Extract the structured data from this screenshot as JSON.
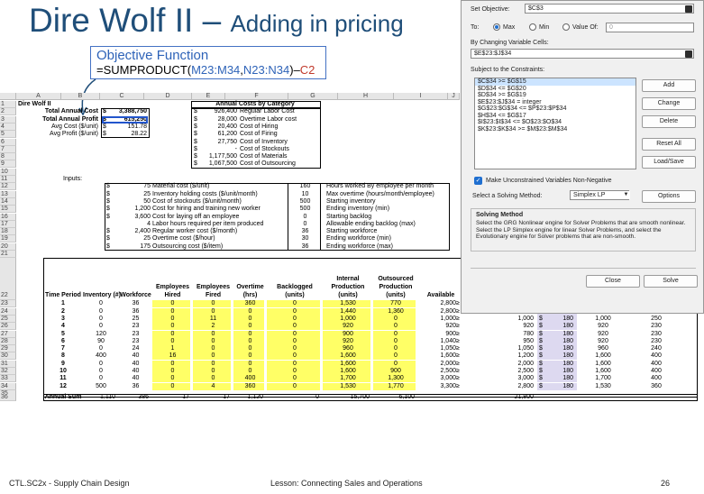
{
  "slide": {
    "title_main": "Dire Wolf II – ",
    "title_sub": "Adding in pricing",
    "footer_left": "CTL.SC2x - Supply Chain Design",
    "footer_center": "Lesson:  Connecting Sales and Operations",
    "page_number": "26"
  },
  "callout": {
    "heading": "Objective Function",
    "prefix": "=SUMPRODUCT(",
    "range1": "M23:M34",
    "comma": ",",
    "range2": "N23:N34",
    "close": ")–",
    "minus": "C2"
  },
  "sheet": {
    "columns": [
      "A",
      "B",
      "C",
      "D",
      "E",
      "F",
      "G",
      "H",
      "I",
      "J"
    ],
    "rows": [
      "1",
      "2",
      "3",
      "4",
      "5",
      "6",
      "7",
      "8",
      "9",
      "10",
      "11",
      "12",
      "13",
      "14",
      "15",
      "16",
      "17",
      "18",
      "19",
      "20",
      "21",
      "22",
      "23",
      "24",
      "25",
      "26",
      "27",
      "28",
      "29",
      "30",
      "31",
      "32",
      "33",
      "34",
      "35",
      "36"
    ],
    "a1": "Dire Wolf II",
    "summary": [
      {
        "label": "Total Annual Cost",
        "cur": "$",
        "value": "3,388,750"
      },
      {
        "label": "Total Annual Profit",
        "cur": "$",
        "value": "615,250"
      },
      {
        "label": "Avg Cost ($/unit)",
        "cur": "$",
        "value": "151.78"
      },
      {
        "label": "Avg Profit ($/unit)",
        "cur": "$",
        "value": "28.22"
      }
    ],
    "cost_title": "Annual Costs by Category",
    "costs": [
      {
        "cur": "$",
        "value": "926,400",
        "label": "Regular Labor Cost"
      },
      {
        "cur": "$",
        "value": "28,000",
        "label": "Overtime Labor cost"
      },
      {
        "cur": "$",
        "value": "20,400",
        "label": "Cost of Hiring"
      },
      {
        "cur": "$",
        "value": "61,200",
        "label": "Cost of Firing"
      },
      {
        "cur": "$",
        "value": "27,750",
        "label": "Cost of Inventory"
      },
      {
        "cur": "$",
        "value": "-",
        "label": "Cost of Stockouts"
      },
      {
        "cur": "$",
        "value": "1,177,500",
        "label": "Cost of Materials"
      },
      {
        "cur": "$",
        "value": "1,067,500",
        "label": "Cost of Outsourcing"
      }
    ],
    "inputs_label": "Inputs:",
    "inputs": [
      {
        "cur": "$",
        "value": "75",
        "label": "Material cost ($/unit)"
      },
      {
        "cur": "$",
        "value": "25",
        "label": "Inventory holding costs ($/unit/month)"
      },
      {
        "cur": "$",
        "value": "50",
        "label": "Cost of stockouts ($/unit/month)"
      },
      {
        "cur": "$",
        "value": "1,200",
        "label": "Cost for hiring and training new worker"
      },
      {
        "cur": "$",
        "value": "3,600",
        "label": "Cost for laying off an employee"
      },
      {
        "cur": "",
        "value": "4",
        "label": "Labor hours required per item produced"
      },
      {
        "cur": "$",
        "value": "2,400",
        "label": "Regular worker cost ($/month)"
      },
      {
        "cur": "$",
        "value": "25",
        "label": "Overtime cost ($/hour)"
      },
      {
        "cur": "$",
        "value": "175",
        "label": "Outsourcing cost ($/item)"
      }
    ],
    "inputs_right": [
      {
        "value": "160",
        "label": "Hours worked By employee per month"
      },
      {
        "value": "10",
        "label": "Max overtime (hours/month/employee)"
      },
      {
        "value": "500",
        "label": "Starting inventory"
      },
      {
        "value": "500",
        "label": "Ending inventory (min)"
      },
      {
        "value": "0",
        "label": "Starting backlog"
      },
      {
        "value": "0",
        "label": "Allowable ending backlog (max)"
      },
      {
        "value": "36",
        "label": "Starting workforce"
      },
      {
        "value": "30",
        "label": "Ending workforce (min)"
      },
      {
        "value": "36",
        "label": "Ending workforce (max)"
      }
    ],
    "table_headers": {
      "period": "Time Period",
      "inventory": "Inventory (#)",
      "workforce": "Workforce",
      "hired": [
        "Employees",
        "Hired"
      ],
      "fired": [
        "Employees",
        "Fired"
      ],
      "overtime": [
        "Overtime",
        "(hrs)"
      ],
      "backlogged": [
        "Backlogged",
        "(units)"
      ],
      "internal": [
        "Internal",
        "Production",
        "(units)"
      ],
      "outsourced": [
        "Outsourced",
        "Production",
        "(units)"
      ],
      "available": "Available",
      "demand": [
        "Monthly",
        "Demand",
        "Forecast",
        "(units)"
      ],
      "price": "Price",
      "maxprod": [
        "Maximum",
        "Production",
        "(units)"
      ],
      "maxot": [
        "Maximum",
        "Overtime",
        "(hours)"
      ]
    },
    "table_rows": [
      {
        "p": "1",
        "inv": "0",
        "wf": "36",
        "hi": "0",
        "fi": "0",
        "ot": "360",
        "bl": "0",
        "ip": "1,530",
        "op": "770",
        "av": "2,800",
        "ge": "≥",
        "dm": "2,800",
        "cur": "$",
        "pr": "180",
        "mp": "1,530",
        "mo": "360"
      },
      {
        "p": "2",
        "inv": "0",
        "wf": "36",
        "hi": "0",
        "fi": "0",
        "ot": "0",
        "bl": "0",
        "ip": "1,440",
        "op": "1,360",
        "av": "2,800",
        "ge": "≥",
        "dm": "2,800",
        "cur": "$",
        "pr": "180",
        "mp": "1,440",
        "mo": "360"
      },
      {
        "p": "3",
        "inv": "0",
        "wf": "25",
        "hi": "0",
        "fi": "11",
        "ot": "0",
        "bl": "0",
        "ip": "1,000",
        "op": "0",
        "av": "1,000",
        "ge": "≥",
        "dm": "1,000",
        "cur": "$",
        "pr": "180",
        "mp": "1,000",
        "mo": "250"
      },
      {
        "p": "4",
        "inv": "0",
        "wf": "23",
        "hi": "0",
        "fi": "2",
        "ot": "0",
        "bl": "0",
        "ip": "920",
        "op": "0",
        "av": "920",
        "ge": "≥",
        "dm": "920",
        "cur": "$",
        "pr": "180",
        "mp": "920",
        "mo": "230"
      },
      {
        "p": "5",
        "inv": "120",
        "wf": "23",
        "hi": "0",
        "fi": "0",
        "ot": "0",
        "bl": "0",
        "ip": "900",
        "op": "0",
        "av": "900",
        "ge": "≥",
        "dm": "780",
        "cur": "$",
        "pr": "180",
        "mp": "920",
        "mo": "230"
      },
      {
        "p": "6",
        "inv": "90",
        "wf": "23",
        "hi": "0",
        "fi": "0",
        "ot": "0",
        "bl": "0",
        "ip": "920",
        "op": "0",
        "av": "1,040",
        "ge": "≥",
        "dm": "950",
        "cur": "$",
        "pr": "180",
        "mp": "920",
        "mo": "230"
      },
      {
        "p": "7",
        "inv": "0",
        "wf": "24",
        "hi": "1",
        "fi": "0",
        "ot": "0",
        "bl": "0",
        "ip": "960",
        "op": "0",
        "av": "1,050",
        "ge": "≥",
        "dm": "1,050",
        "cur": "$",
        "pr": "180",
        "mp": "960",
        "mo": "240"
      },
      {
        "p": "8",
        "inv": "400",
        "wf": "40",
        "hi": "16",
        "fi": "0",
        "ot": "0",
        "bl": "0",
        "ip": "1,600",
        "op": "0",
        "av": "1,600",
        "ge": "≥",
        "dm": "1,200",
        "cur": "$",
        "pr": "180",
        "mp": "1,600",
        "mo": "400"
      },
      {
        "p": "9",
        "inv": "0",
        "wf": "40",
        "hi": "0",
        "fi": "0",
        "ot": "0",
        "bl": "0",
        "ip": "1,600",
        "op": "0",
        "av": "2,000",
        "ge": "≥",
        "dm": "2,000",
        "cur": "$",
        "pr": "180",
        "mp": "1,600",
        "mo": "400"
      },
      {
        "p": "10",
        "inv": "0",
        "wf": "40",
        "hi": "0",
        "fi": "0",
        "ot": "0",
        "bl": "0",
        "ip": "1,600",
        "op": "900",
        "av": "2,500",
        "ge": "≥",
        "dm": "2,500",
        "cur": "$",
        "pr": "180",
        "mp": "1,600",
        "mo": "400"
      },
      {
        "p": "11",
        "inv": "0",
        "wf": "40",
        "hi": "0",
        "fi": "0",
        "ot": "400",
        "bl": "0",
        "ip": "1,700",
        "op": "1,300",
        "av": "3,000",
        "ge": "≥",
        "dm": "3,000",
        "cur": "$",
        "pr": "180",
        "mp": "1,700",
        "mo": "400"
      },
      {
        "p": "12",
        "inv": "500",
        "wf": "36",
        "hi": "0",
        "fi": "4",
        "ot": "360",
        "bl": "0",
        "ip": "1,530",
        "op": "1,770",
        "av": "3,300",
        "ge": "≥",
        "dm": "2,800",
        "cur": "$",
        "pr": "180",
        "mp": "1,530",
        "mo": "360"
      }
    ],
    "sum_row": {
      "label": "Annual Sum",
      "inv": "1,110",
      "wf": "386",
      "hi": "17",
      "fi": "17",
      "ot": "1,120",
      "bl": "0",
      "ip": "15,700",
      "op": "6,100",
      "dm": "21,800"
    }
  },
  "solver": {
    "set_objective_label": "Set Objective:",
    "set_objective_value": "$C$3",
    "to_label": "To:",
    "max_label": "Max",
    "min_label": "Min",
    "value_of_label": "Value Of:",
    "value_of_value": "0",
    "by_changing_label": "By Changing Variable Cells:",
    "by_changing_value": "$E$23:$J$34",
    "subject_label": "Subject to the Constraints:",
    "constraints": [
      "$C$34 >= $G$15",
      "$D$34 <= $G$20",
      "$D$34 >= $G$19",
      "$E$23:$J$34 = integer",
      "$G$23:$G$34 <= $P$23:$P$34",
      "$H$34 <= $G$17",
      "$I$23:$I$34 <= $O$23:$O$34",
      "$K$23:$K$34 >= $M$23:$M$34"
    ],
    "buttons": {
      "add": "Add",
      "change": "Change",
      "delete": "Delete",
      "reset": "Reset All",
      "loadsave": "Load/Save",
      "options": "Options",
      "close": "Close",
      "solve": "Solve"
    },
    "make_unconstrained": "Make Unconstrained Variables Non-Negative",
    "select_method_label": "Select a Solving Method:",
    "method_value": "Simplex LP",
    "solving_method_heading": "Solving Method",
    "solving_method_text": "Select the GRG Nonlinear engine for Solver Problems that are smooth nonlinear. Select the LP Simplex engine for linear Solver Problems, and select the Evolutionary engine for Solver problems that are non-smooth."
  },
  "colors": {
    "title": "#1f4e79",
    "callout_border": "#4472c4",
    "highlight_yellow": "#ffff66",
    "highlight_lavender": "#ddd9f0",
    "radio_accent": "#1f6fd0"
  }
}
